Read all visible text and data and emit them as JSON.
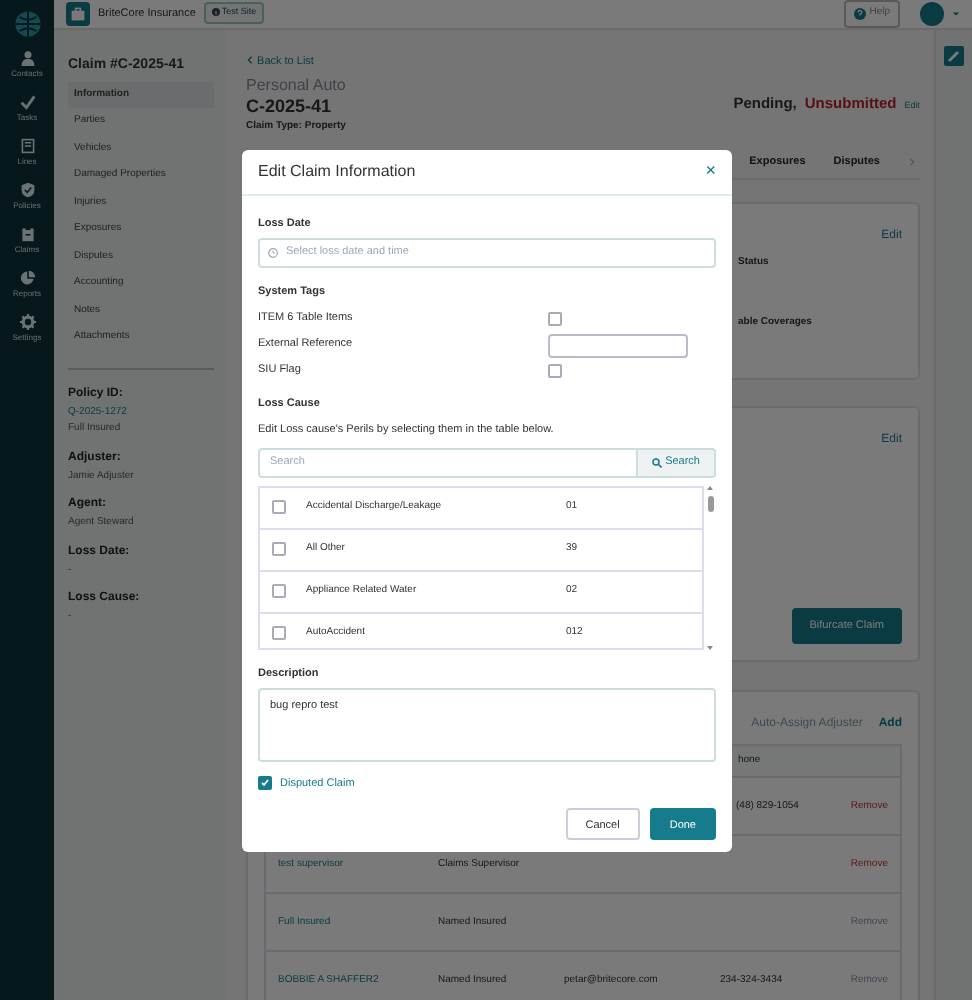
{
  "nav_rail": {
    "items": [
      {
        "label": "Contacts"
      },
      {
        "label": "Tasks"
      },
      {
        "label": "Lines"
      },
      {
        "label": "Policies"
      },
      {
        "label": "Claims"
      },
      {
        "label": "Reports"
      },
      {
        "label": "Settings"
      }
    ]
  },
  "top_bar": {
    "company": "BriteCore Insurance",
    "badge": "Test Site",
    "help": "Help"
  },
  "claim_sidebar": {
    "title": "Claim #C-2025-41",
    "items": [
      {
        "label": "Information",
        "selected": true
      },
      {
        "label": "Parties",
        "selected": false
      },
      {
        "label": "Vehicles",
        "selected": false
      },
      {
        "label": "Damaged Properties",
        "selected": false
      },
      {
        "label": "Injuries",
        "selected": false
      },
      {
        "label": "Exposures",
        "selected": false
      },
      {
        "label": "Disputes",
        "selected": false
      },
      {
        "label": "Accounting",
        "selected": false
      },
      {
        "label": "Notes",
        "selected": false
      },
      {
        "label": "Attachments",
        "selected": false
      }
    ],
    "details": [
      {
        "label": "Policy ID:",
        "values": [
          {
            "text": "Q-2025-1272",
            "kind": "link"
          },
          {
            "text": "Full Insured",
            "kind": "text"
          }
        ]
      },
      {
        "label": "Adjuster:",
        "values": [
          {
            "text": "Jamie Adjuster",
            "kind": "text"
          }
        ]
      },
      {
        "label": "Agent:",
        "values": [
          {
            "text": "Agent Steward",
            "kind": "text"
          }
        ]
      },
      {
        "label": "Loss Date:",
        "values": [
          {
            "text": "-",
            "kind": "text"
          }
        ]
      },
      {
        "label": "Loss Cause:",
        "values": [
          {
            "text": "-",
            "kind": "text"
          }
        ]
      }
    ]
  },
  "header": {
    "back_link": "Back to List",
    "line": "Personal Auto",
    "claim_number": "C-2025-41",
    "claim_type": "Claim Type: Property",
    "status": "Pending,",
    "status_flag": "Unsubmitted",
    "edit": "Edit"
  },
  "tabs": [
    {
      "label": "Exposures"
    },
    {
      "label": "Disputes"
    }
  ],
  "status_card": {
    "edit": "Edit",
    "texts": [
      "Status",
      "able Coverages"
    ]
  },
  "bifurcate_card": {
    "edit": "Edit",
    "button": "Bifurcate Claim"
  },
  "contacts_card": {
    "actions": [
      "Auto-Assign Adjuster",
      "Add"
    ],
    "column": "hone",
    "rows": [
      {
        "phone": "(48) 829-1054",
        "remove": "Remove",
        "disabled": false
      },
      {
        "name": "test supervisor",
        "role": "Claims Supervisor",
        "remove": "Remove",
        "disabled": false
      },
      {
        "name": "Full Insured",
        "role": "Named Insured",
        "remove": "Remove",
        "disabled": true
      },
      {
        "name": "BOBBIE A SHAFFER2",
        "role": "Named Insured",
        "email": "petar@britecore.com",
        "phone": "234-324-3434",
        "remove": "Remove",
        "disabled": true
      }
    ]
  },
  "modal": {
    "title": "Edit Claim Information",
    "close": "×",
    "loss_date": {
      "label": "Loss Date",
      "placeholder": "Select loss date and time"
    },
    "system_tags": {
      "heading": "System Tags",
      "rows": [
        {
          "label": "ITEM 6 Table Items",
          "kind": "checkbox",
          "checked": false
        },
        {
          "label": "External Reference",
          "kind": "text"
        },
        {
          "label": "SIU Flag",
          "kind": "checkbox",
          "checked": false
        }
      ]
    },
    "loss_cause": {
      "heading": "Loss Cause",
      "help": "Edit Loss cause's Perils by selecting them in the table below.",
      "search_placeholder": "Search",
      "search_button": "Search",
      "perils": [
        {
          "name": "Accidental Discharge/Leakage",
          "code": "01",
          "checked": false
        },
        {
          "name": "All Other",
          "code": "39",
          "checked": false
        },
        {
          "name": "Appliance Related Water",
          "code": "02",
          "checked": false
        },
        {
          "name": "AutoAccident",
          "code": "012",
          "checked": false
        }
      ]
    },
    "description": {
      "label": "Description",
      "value": "bug repro test"
    },
    "disputed": {
      "label": "Disputed Claim",
      "checked": true
    },
    "buttons": [
      {
        "label": "Cancel",
        "kind": "secondary"
      },
      {
        "label": "Done",
        "kind": "primary"
      }
    ]
  }
}
